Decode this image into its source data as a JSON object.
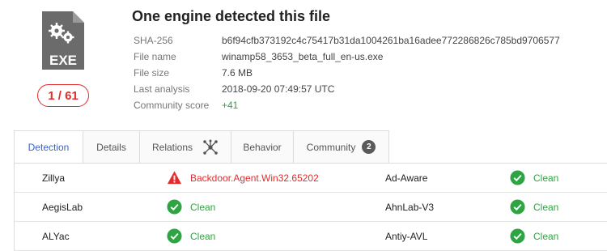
{
  "summary": {
    "file_type_label": "EXE",
    "detection_ratio": "1 / 61",
    "headline": "One engine detected this file",
    "details": [
      {
        "label": "SHA-256",
        "value": "b6f94cfb373192c4c75417b31da1004261ba16adee772286826c785bd9706577"
      },
      {
        "label": "File name",
        "value": "winamp58_3653_beta_full_en-us.exe"
      },
      {
        "label": "File size",
        "value": "7.6 MB"
      },
      {
        "label": "Last analysis",
        "value": "2018-09-20 07:49:57 UTC"
      },
      {
        "label": "Community score",
        "value": "+41"
      }
    ]
  },
  "tabs": [
    {
      "label": "Detection",
      "active": true
    },
    {
      "label": "Details"
    },
    {
      "label": "Relations",
      "icon": "graph-network-icon"
    },
    {
      "label": "Behavior"
    },
    {
      "label": "Community",
      "badge": "2"
    }
  ],
  "results": [
    {
      "left": {
        "engine": "Zillya",
        "verdict": "Backdoor.Agent.Win32.65202",
        "status": "threat"
      },
      "right": {
        "engine": "Ad-Aware",
        "verdict": "Clean",
        "status": "clean"
      }
    },
    {
      "left": {
        "engine": "AegisLab",
        "verdict": "Clean",
        "status": "clean"
      },
      "right": {
        "engine": "AhnLab-V3",
        "verdict": "Clean",
        "status": "clean"
      }
    },
    {
      "left": {
        "engine": "ALYac",
        "verdict": "Clean",
        "status": "clean"
      },
      "right": {
        "engine": "Antiy-AVL",
        "verdict": "Clean",
        "status": "clean"
      }
    }
  ],
  "colors": {
    "accent": "#3b61c9",
    "clean": "#2fa443",
    "threat": "#e12d2d",
    "icon_gray": "#6b6b6b"
  },
  "icons": {
    "file": "exe-file-icon",
    "clean": "check-circle-icon",
    "threat": "warning-triangle-icon"
  }
}
